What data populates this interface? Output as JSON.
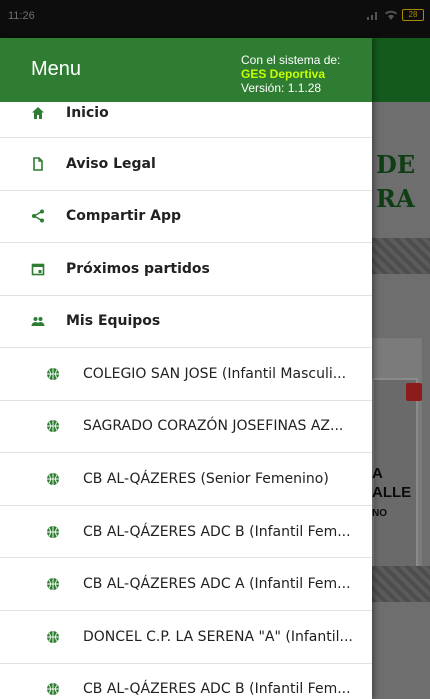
{
  "status_bar": {
    "time": "11:26",
    "battery": "28"
  },
  "drawer": {
    "title": "Menu",
    "system_line1": "Con el sistema de:",
    "system_brand": "GES Deportiva",
    "version": "Versión: 1.1.28",
    "items": [
      {
        "label": "Inicio",
        "icon": "home-icon"
      },
      {
        "label": "Aviso Legal",
        "icon": "document-icon"
      },
      {
        "label": "Compartir App",
        "icon": "share-icon"
      },
      {
        "label": "Próximos partidos",
        "icon": "calendar-icon"
      },
      {
        "label": "Mis Equipos",
        "icon": "group-icon"
      }
    ],
    "teams": [
      "COLEGIO SAN JOSE (Infantil Masculi...",
      "SAGRADO CORAZÓN JOSEFINAS AZ...",
      "CB AL-QÁZERES (Senior Femenino)",
      "CB AL-QÁZERES ADC B (Infantil Fem...",
      "CB AL-QÁZERES ADC A (Infantil Fem...",
      "DONCEL C.P. LA SERENA \"A\" (Infantil...",
      "CB AL-QÁZERES ADC B (Infantil Fem..."
    ]
  },
  "background": {
    "title_line1": "DE",
    "title_line2": "RA",
    "card_line1": "A",
    "card_line2": "ALLE",
    "card_line3": "NO"
  },
  "colors": {
    "accent": "#2e7d32",
    "brand": "#c6ff00",
    "icon": "#2e7d32"
  }
}
